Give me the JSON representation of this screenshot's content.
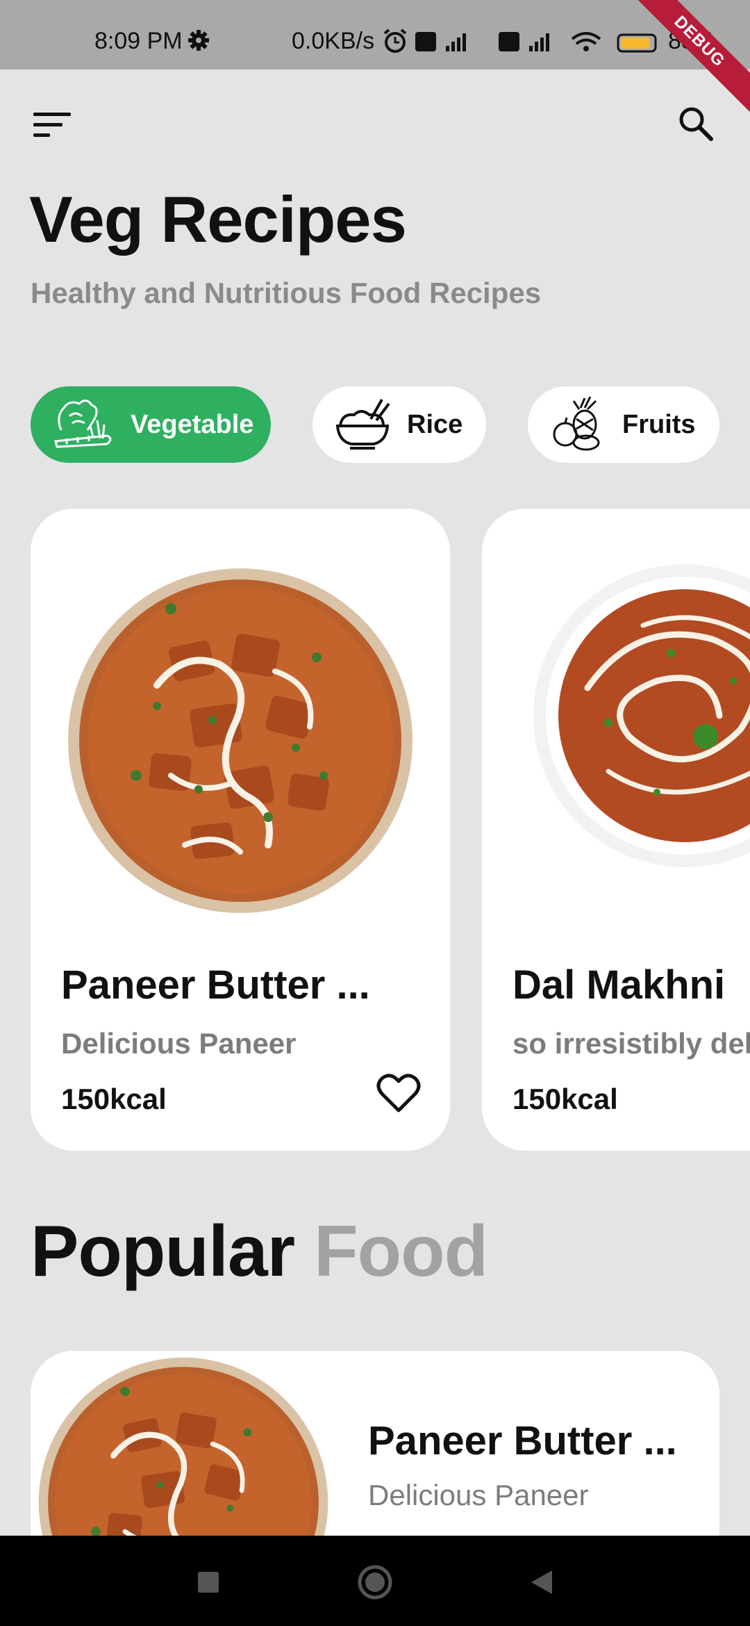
{
  "status_bar": {
    "time": "8:09 PM",
    "network_speed": "0.0KB/s",
    "battery": "83%",
    "debug_banner": "DEBUG",
    "icons": [
      "settings-icon",
      "alarm-icon",
      "volte-icon",
      "signal-icon",
      "wifi-icon",
      "battery-icon"
    ]
  },
  "header": {
    "title": "Veg Recipes",
    "subtitle": "Healthy and Nutritious Food Recipes"
  },
  "categories": [
    {
      "label": "Vegetable",
      "icon": "vegetable-icon",
      "selected": true
    },
    {
      "label": "Rice",
      "icon": "rice-bowl-icon",
      "selected": false
    },
    {
      "label": "Fruits",
      "icon": "fruits-icon",
      "selected": false
    }
  ],
  "recipes": [
    {
      "name": "Paneer Butter ...",
      "description": "Delicious Paneer",
      "calories": "150kcal",
      "favorite_icon": "heart-outline-icon"
    },
    {
      "name": "Dal Makhni",
      "description": "so irresistibly deli",
      "calories": "150kcal"
    }
  ],
  "popular": {
    "title_word_1": "Popular",
    "title_word_2": "Food",
    "items": [
      {
        "name": "Paneer Butter ...",
        "description": "Delicious Paneer"
      }
    ]
  },
  "colors": {
    "accent": "#2eb060",
    "background": "#e4e4e4",
    "card": "#ffffff",
    "muted_text": "#8a8a8a",
    "debug_ribbon": "#b71c3b"
  }
}
